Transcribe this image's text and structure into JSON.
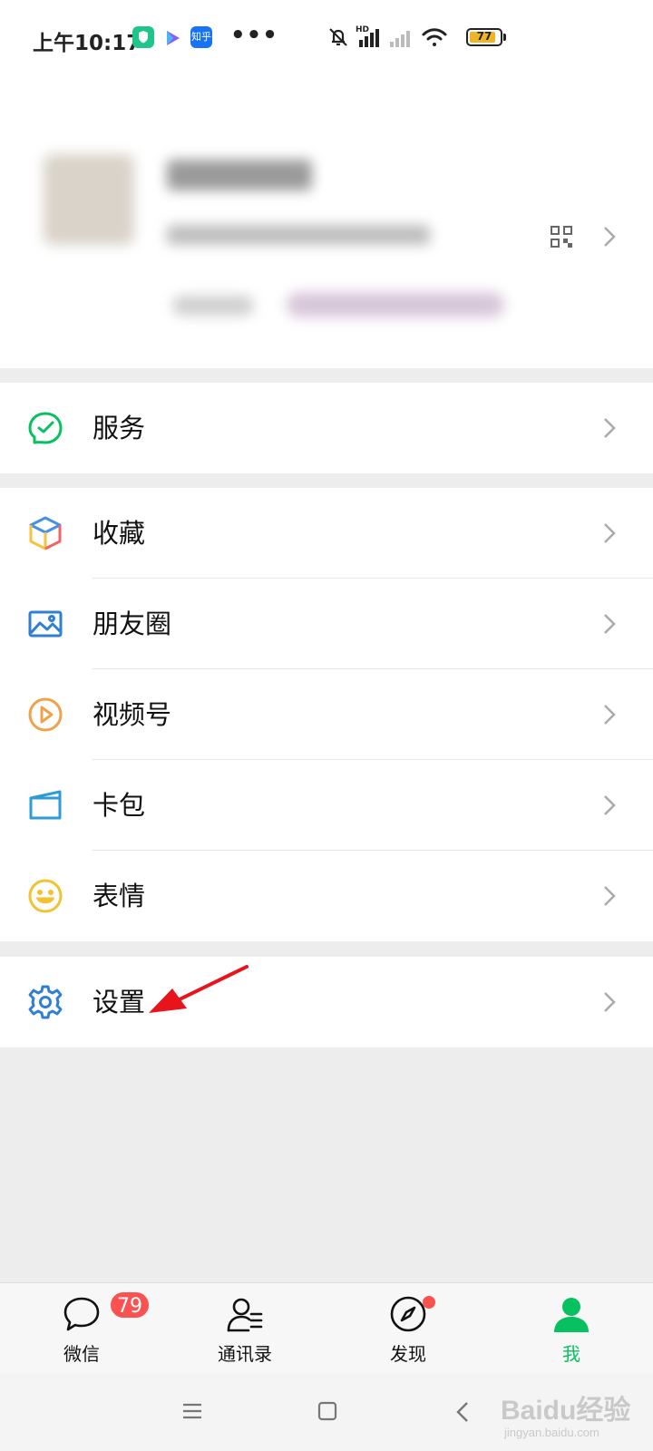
{
  "status_bar": {
    "time": "上午10:17",
    "more": "•••",
    "battery": "77",
    "apps": [
      {
        "name": "security-app-icon",
        "color": "#1fc58a"
      },
      {
        "name": "video-app-icon",
        "color": "#8a5cf6"
      },
      {
        "name": "zhihu-app-icon",
        "color": "#1772f6",
        "text": "知乎"
      }
    ]
  },
  "menu": {
    "services": "服务",
    "favorites": "收藏",
    "moments": "朋友圈",
    "channels": "视频号",
    "cards": "卡包",
    "stickers": "表情",
    "settings": "设置"
  },
  "tabs": {
    "chats": {
      "label": "微信",
      "badge": "79"
    },
    "contacts": {
      "label": "通讯录"
    },
    "discover": {
      "label": "发现"
    },
    "me": {
      "label": "我"
    }
  },
  "watermark": {
    "brand": "Baidu经验",
    "url": "jingyan.baidu.com"
  },
  "colors": {
    "accent": "#07c160",
    "badge": "#fa5151",
    "annotation_arrow": "#e8141b"
  }
}
